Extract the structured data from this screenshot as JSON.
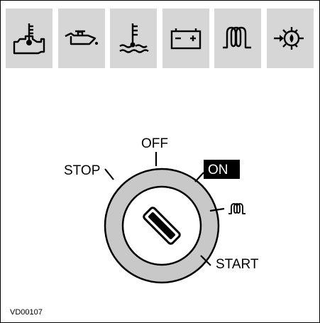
{
  "warning_icons": [
    {
      "name": "engine-temperature-icon"
    },
    {
      "name": "oil-pressure-icon"
    },
    {
      "name": "coolant-temperature-icon"
    },
    {
      "name": "battery-charge-icon"
    },
    {
      "name": "preheat-glow-plug-icon"
    },
    {
      "name": "transmission-icon"
    }
  ],
  "key_switch": {
    "positions": {
      "stop": "STOP",
      "off": "OFF",
      "on": "ON",
      "start": "START"
    }
  },
  "figure_code": "VD00107",
  "colors": {
    "tile_background": "#d6d6d6",
    "switch_ring": "#c8c8c8",
    "on_label_background": "#000000"
  }
}
